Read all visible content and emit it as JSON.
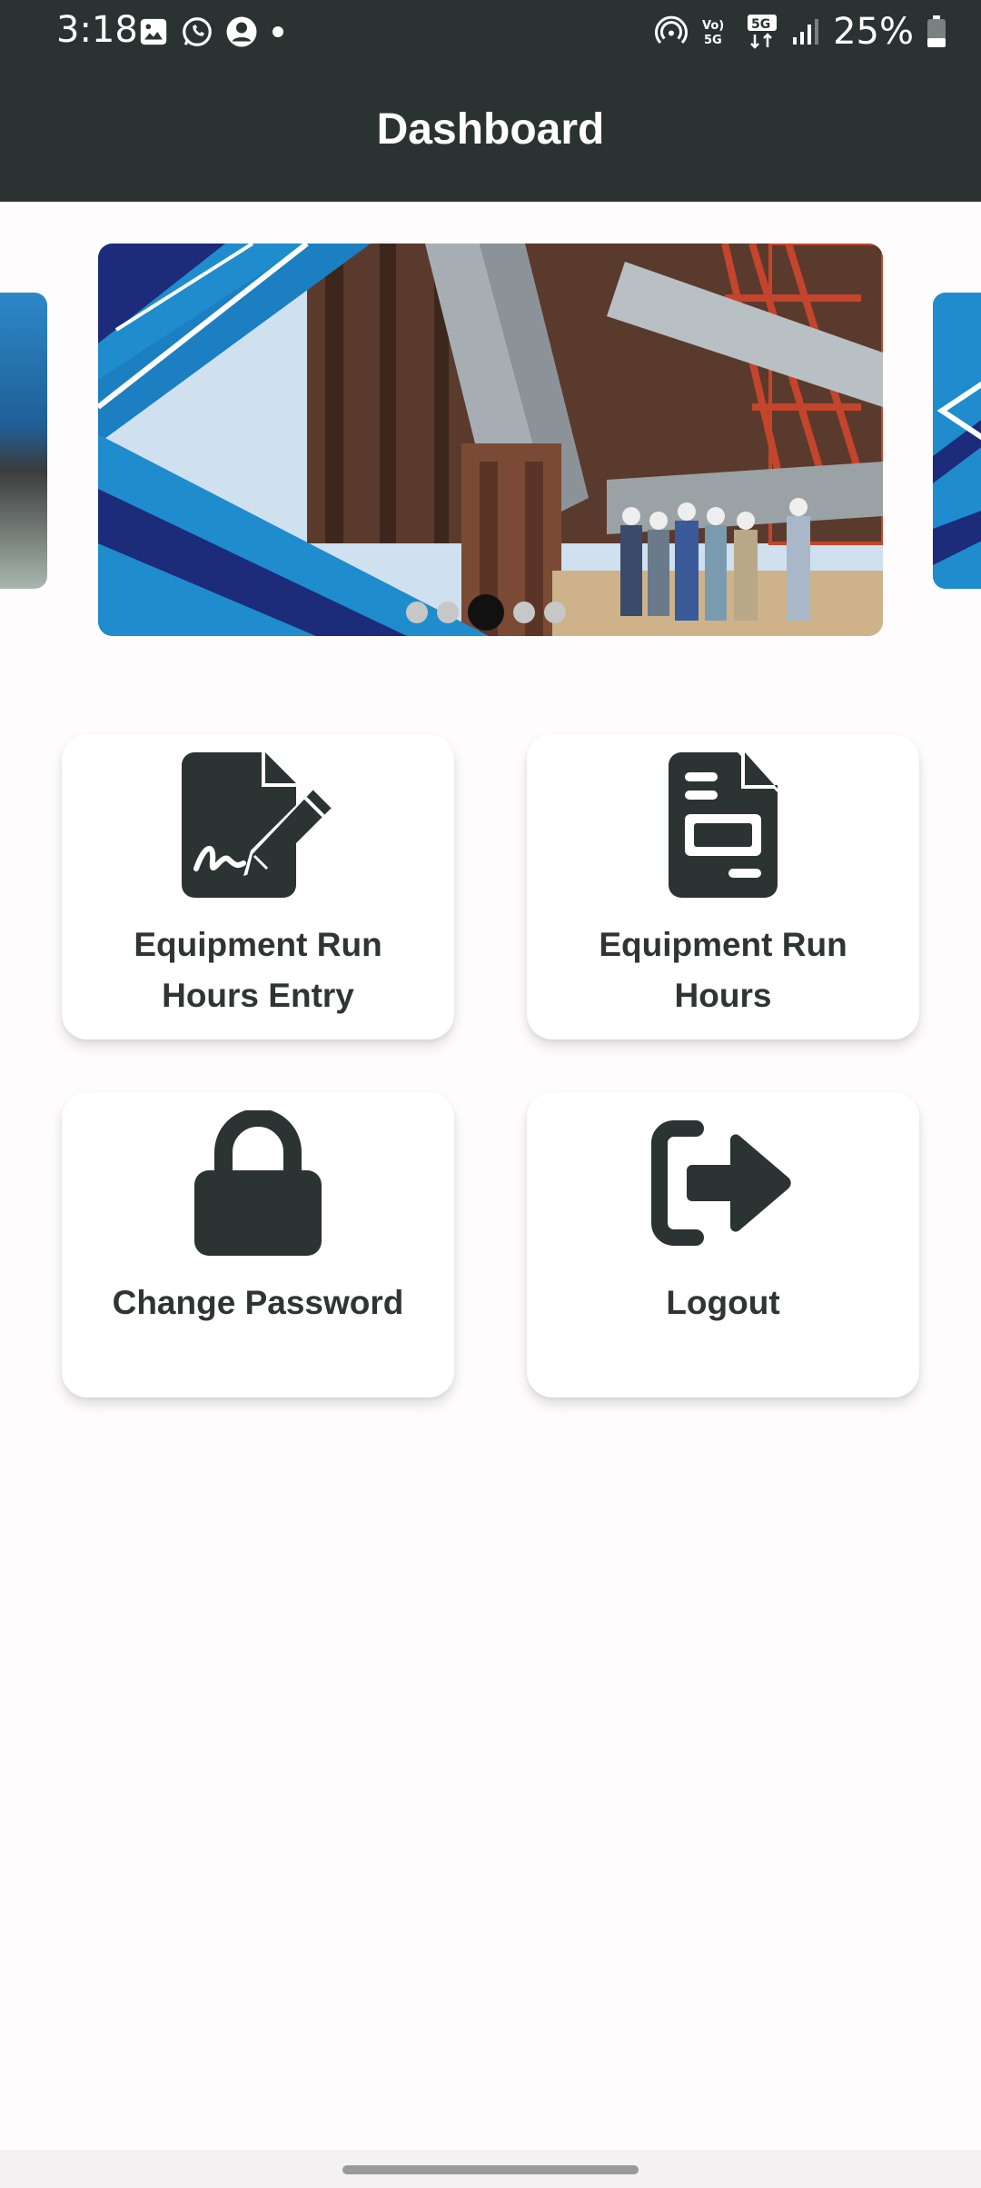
{
  "status_bar": {
    "time": "3:18",
    "battery_percent": "25%",
    "notification_icons": [
      "gallery-icon",
      "whatsapp-icon",
      "account-icon",
      "dot-icon"
    ],
    "system_icons": [
      "hotspot-icon",
      "volte-icon",
      "5g-icon",
      "signal-icon",
      "battery-icon"
    ]
  },
  "app_bar": {
    "title": "Dashboard"
  },
  "carousel": {
    "slide_count": 5,
    "active_index": 2
  },
  "menu": {
    "items": [
      {
        "label": "Equipment Run Hours Entry",
        "icon": "file-signature-icon"
      },
      {
        "label": "Equipment Run Hours",
        "icon": "document-icon"
      },
      {
        "label": "Change Password",
        "icon": "lock-icon"
      },
      {
        "label": "Logout",
        "icon": "logout-icon"
      }
    ]
  },
  "colors": {
    "app_bar": "#2a3332",
    "icon": "#2b3433",
    "card": "#ffffff",
    "background": "#fefcfd"
  }
}
